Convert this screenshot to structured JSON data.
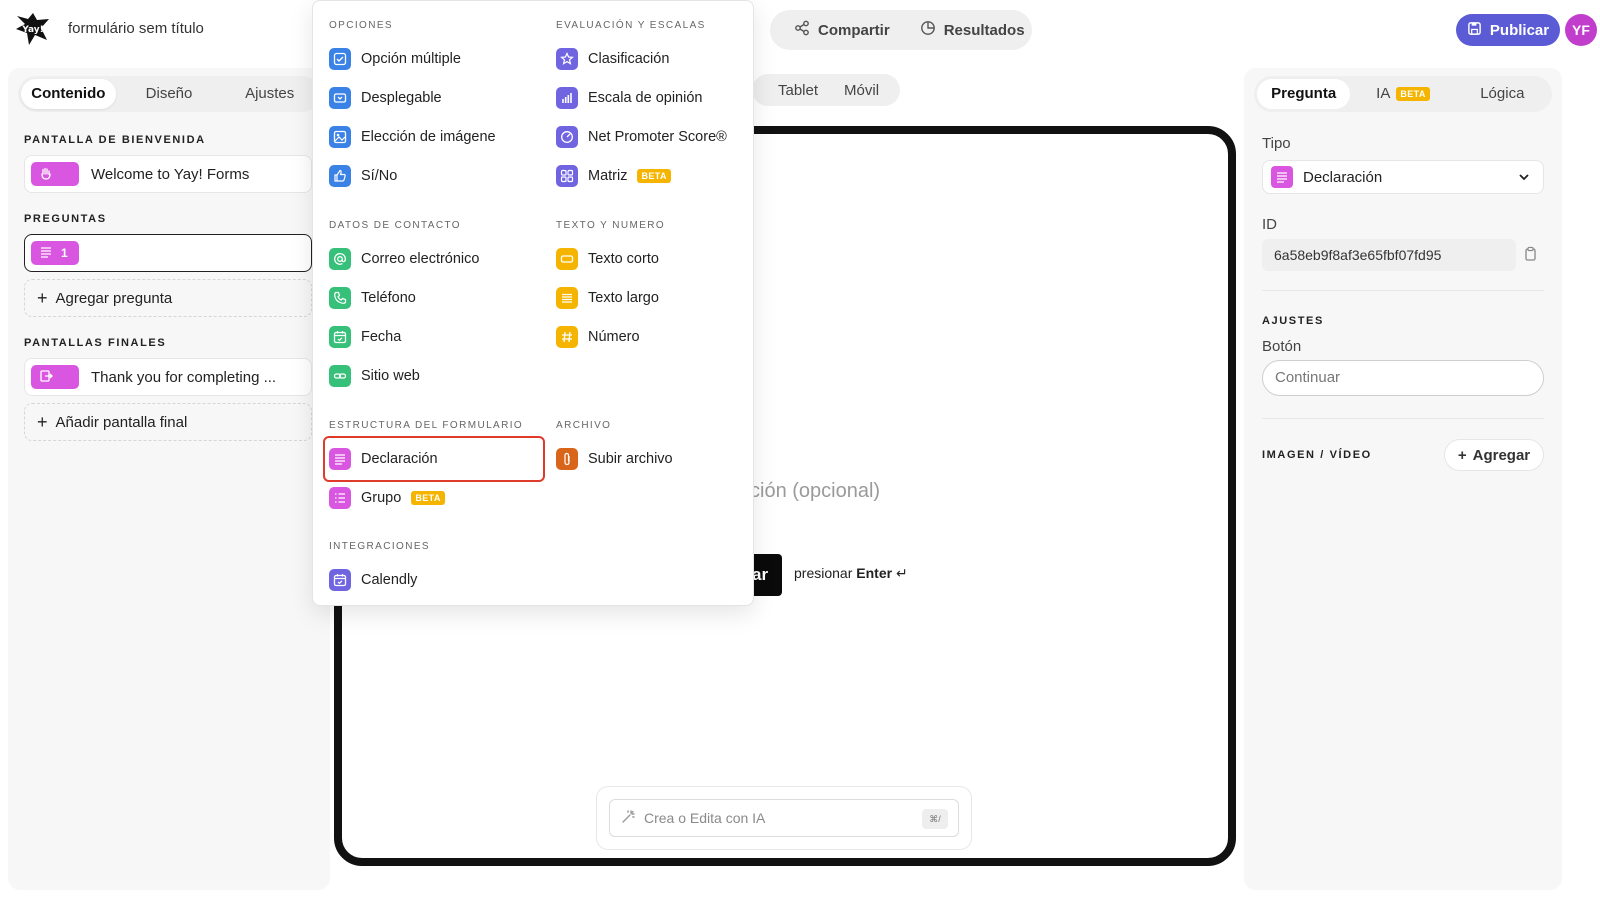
{
  "header": {
    "form_title": "formulário sem título",
    "share_label": "Compartir",
    "results_label": "Resultados",
    "publish_label": "Publicar",
    "avatar_initials": "YF"
  },
  "left": {
    "tabs": [
      "Contenido",
      "Diseño",
      "Ajustes"
    ],
    "welcome_label": "PANTALLA DE BIENVENIDA",
    "welcome_item": "Welcome to Yay! Forms",
    "questions_label": "PREGUNTAS",
    "question_number": "1",
    "add_question": "Agregar pregunta",
    "endings_label": "PANTALLAS FINALES",
    "ending_item": "Thank you for completing ...",
    "add_ending": "Añadir pantalla final"
  },
  "center": {
    "view_tabs": [
      "Tablet",
      "Móvil"
    ],
    "description_placeholder": "ción (opcional)",
    "continue_partial": "ar",
    "enter_hint_prefix": "presionar",
    "enter_hint_key": "Enter",
    "ai_placeholder": "Crea o Edita con IA",
    "ai_shortcut": "⌘/"
  },
  "menu": {
    "options_label": "OPCIONES",
    "options": [
      "Opción múltiple",
      "Desplegable",
      "Elección de imágene",
      "Sí/No"
    ],
    "scales_label": "EVALUACIÓN Y ESCALAS",
    "scales": [
      "Clasificación",
      "Escala de opinión",
      "Net Promoter Score®",
      "Matriz"
    ],
    "contact_label": "DATOS DE CONTACTO",
    "contact": [
      "Correo electrónico",
      "Teléfono",
      "Fecha",
      "Sitio web"
    ],
    "text_label": "TEXTO Y NUMERO",
    "text": [
      "Texto corto",
      "Texto largo",
      "Número"
    ],
    "structure_label": "ESTRUCTURA DEL FORMULARIO",
    "structure": [
      "Declaración",
      "Grupo"
    ],
    "file_label": "ARCHIVO",
    "file": [
      "Subir archivo"
    ],
    "integrations_label": "INTEGRACIONES",
    "integrations": [
      "Calendly"
    ],
    "beta_badge": "BETA"
  },
  "right": {
    "tabs": [
      "Pregunta",
      "IA",
      "Lógica"
    ],
    "type_label": "Tipo",
    "type_value": "Declaración",
    "id_label": "ID",
    "id_value": "6a58eb9f8af3e65fbf07fd95",
    "settings_label": "AJUSTES",
    "button_label": "Botón",
    "button_placeholder": "Continuar",
    "media_label": "IMAGEN / VÍDEO",
    "add_label": "Agregar"
  },
  "colors": {
    "accent": "#5b5bd6",
    "statement": "#d956e0",
    "highlight": "#de3b2a",
    "beta": "#f5b400"
  }
}
